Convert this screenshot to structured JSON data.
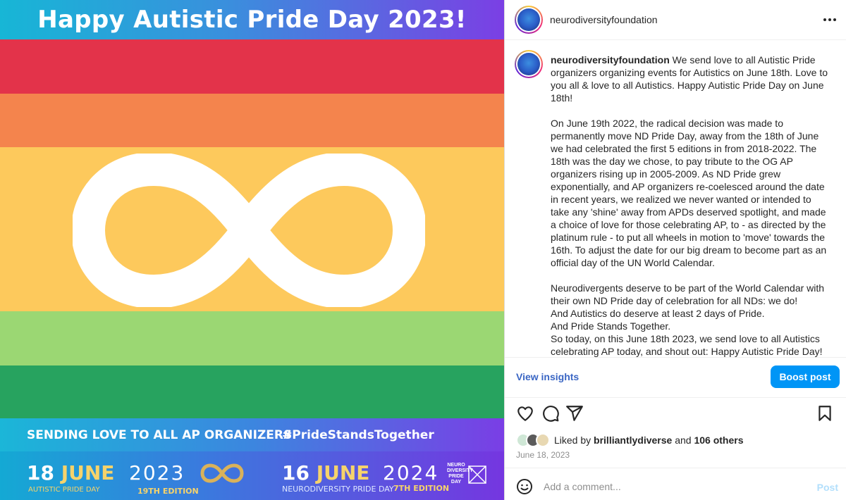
{
  "image": {
    "header_title": "Happy Autistic Pride Day 2023!",
    "banner_left": "SENDING LOVE TO ALL AP ORGANIZERS",
    "banner_right": "#PrideStandsTogether",
    "footer": {
      "day1": "18",
      "month1": "JUNE",
      "year1": "2023",
      "sub1": "AUTISTIC PRIDE DAY",
      "edition1": "19TH EDITION",
      "day2": "16",
      "month2": "JUNE",
      "year2": "2024",
      "sub2": "NEURODIVERSITY PRIDE DAY",
      "edition2": "7TH EDITION",
      "logo_text": "NEURO DIVERSITY PRIDE DAY"
    },
    "colors": {
      "red": "#e3334a",
      "orange": "#f4844d",
      "yellow": "#fdc95c",
      "light_green": "#9bd773",
      "green": "#27a35f"
    }
  },
  "header": {
    "username": "neurodiversityfoundation",
    "more_icon": "more-horizontal-icon"
  },
  "caption": {
    "username": "neurodiversityfoundation",
    "text": " We send love to all Autistic Pride organizers organizing events for Autistics on June 18th. Love to you all & love to all Autistics. Happy Autistic Pride Day on June 18th!\n\nOn June 19th 2022, the radical decision was made to permanently move ND Pride Day, away from the 18th of June we had celebrated the first 5 editions in from 2018-2022. The 18th was the day we chose, to pay tribute to the OG AP organizers rising up in 2005-2009. As ND Pride grew exponentially, and AP organizers re-coelesced around the date in recent years, we realized we never wanted or intended to take any 'shine' away from APDs deserved spotlight, and made a choice of love for those celebrating AP, to - as directed by the platinum rule - to put all wheels in motion to 'move' towards the 16th. To adjust the date for our big dream to become part as an official day of the UN World Calendar.\n\nNeurodivergents deserve to be part of the World Calendar with their own ND Pride day of celebration for all NDs: we do!\nAnd Autistics do deserve at least 2 days of Pride.\nAnd Pride Stands Together.\nSo today, on this June 18th 2023, we send love to all Autistics celebrating AP today, and shout out: Happy Autistic Pride Day!"
  },
  "insights": {
    "view_label": "View insights",
    "boost_label": "Boost post"
  },
  "likes": {
    "prefix": "Liked by ",
    "user": "brilliantlydiverse",
    "middle": " and ",
    "others": "106 others"
  },
  "post_date": "June 18, 2023",
  "comment": {
    "placeholder": "Add a comment...",
    "post_label": "Post"
  },
  "accent_colors": {
    "boost_button": "#0095f6",
    "link": "#3a66c4"
  }
}
